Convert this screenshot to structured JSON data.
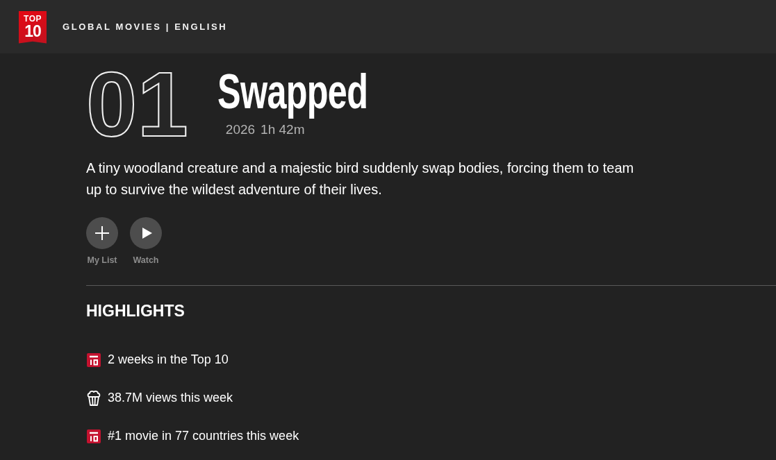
{
  "header": {
    "logo": {
      "top": "TOP",
      "number": "10"
    },
    "title": "GLOBAL MOVIES | ENGLISH"
  },
  "movie": {
    "rank": "01",
    "title": "Swapped",
    "year": "2026",
    "runtime": "1h 42m",
    "description": "A tiny woodland creature and a majestic bird suddenly swap bodies, forcing them to team up to survive the wildest adventure of their lives."
  },
  "actions": [
    {
      "kind": "add",
      "label": "My List"
    },
    {
      "kind": "play",
      "label": "Watch"
    }
  ],
  "highlights": {
    "heading": "HIGHLIGHTS",
    "items": [
      {
        "kind": "top10",
        "text": "2 weeks in the Top 10"
      },
      {
        "kind": "popcorn",
        "text": "38.7M views this week"
      },
      {
        "kind": "top10",
        "text": "#1 movie in 77 countries this week"
      }
    ]
  }
}
